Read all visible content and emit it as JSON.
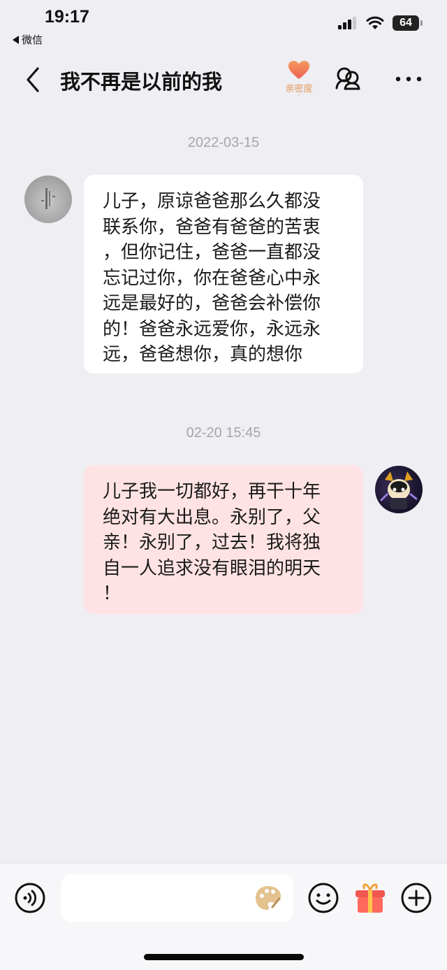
{
  "status_bar": {
    "time": "19:17",
    "back_app": "微信",
    "battery": "64"
  },
  "nav": {
    "title": "我不再是以前的我",
    "intimacy_label": "亲密度",
    "intimacy_sub": "-",
    "icons": [
      "back-chevron-icon",
      "heart-icon",
      "friend-settings-icon",
      "more-icon"
    ]
  },
  "messages": [
    {
      "timestamp": "2022-03-15",
      "side": "left",
      "lines": [
        "儿子，原谅爸爸那么久都没",
        "联系你，爸爸有爸爸的苦衷",
        "，但你记住，爸爸一直都没",
        "忘记过你，你在爸爸心中永",
        "远是最好的，爸爸会补偿你",
        "的！爸爸永远爱你，永远永",
        "远，爸爸想你，真的想你"
      ]
    },
    {
      "timestamp": "02-20 15:45",
      "side": "right",
      "lines": [
        "儿子我一切都好，再干十年",
        "绝对有大出息。永别了，父",
        "亲！永别了，过去！我将独",
        "自一人追求没有眼泪的明天",
        "！"
      ]
    }
  ],
  "input_bar": {
    "placeholder": "",
    "icons": [
      "voice-icon",
      "palette-icon",
      "emoji-icon",
      "gift-icon",
      "plus-icon"
    ]
  },
  "colors": {
    "background": "#eeeef3",
    "bubble_left": "#ffffff",
    "bubble_right": "#ffe3e4",
    "timestamp": "#a5a5ab",
    "intimacy": "#e39a5a",
    "heart": "#f07a55"
  }
}
